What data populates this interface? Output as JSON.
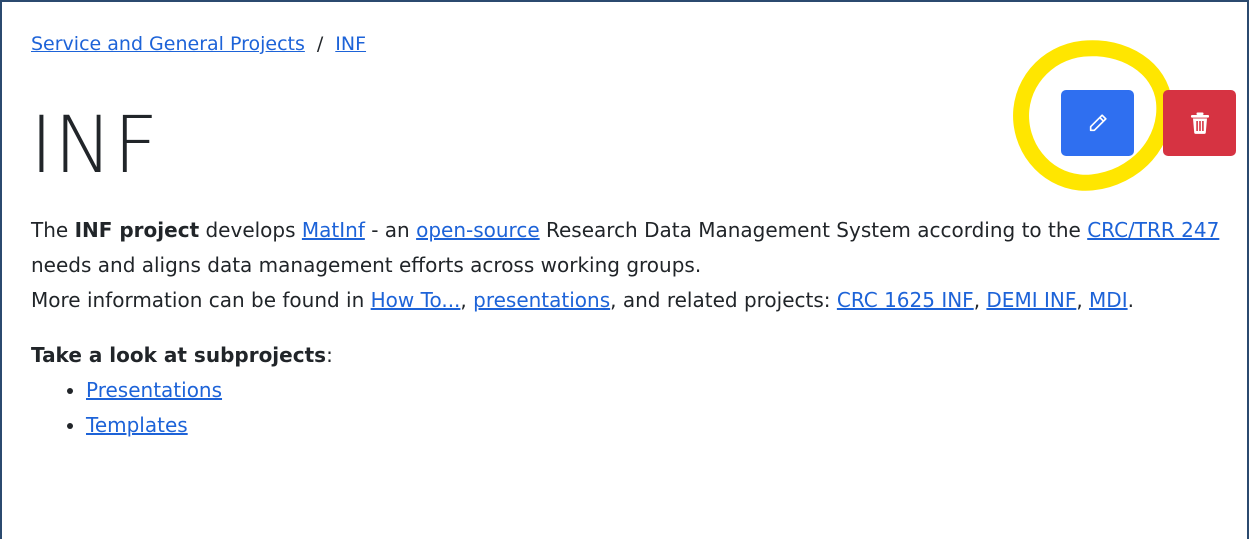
{
  "breadcrumb": {
    "items": [
      {
        "label": "Service and General Projects"
      },
      {
        "label": "INF"
      }
    ],
    "separator": "/"
  },
  "title": "INF",
  "actions": {
    "edit_icon": "pencil-icon",
    "delete_icon": "trash-icon",
    "edit_color": "#2f6ff0",
    "delete_color": "#d63342",
    "highlight_color": "#ffe600"
  },
  "description": {
    "t1": "The ",
    "bold1": "INF project",
    "t2": " develops ",
    "link_matinf": "MatInf",
    "t3": " - an ",
    "link_opensource": "open-source",
    "t4": " Research Data Management System according to the ",
    "link_crc": "CRC/TRR 247",
    "t5": " needs and aligns data management efforts across working groups.",
    "t6": "More information can be found in ",
    "link_howto": "How To...",
    "t7": ", ",
    "link_presentations": "presentations",
    "t8": ", and related projects: ",
    "link_crc1625": "CRC 1625 INF",
    "t9": ", ",
    "link_demi": "DEMI INF",
    "t10": ", ",
    "link_mdi": "MDI",
    "t11": "."
  },
  "subprojects": {
    "heading": "Take a look at subprojects",
    "heading_suffix": ":",
    "items": [
      {
        "label": "Presentations"
      },
      {
        "label": "Templates"
      }
    ]
  }
}
